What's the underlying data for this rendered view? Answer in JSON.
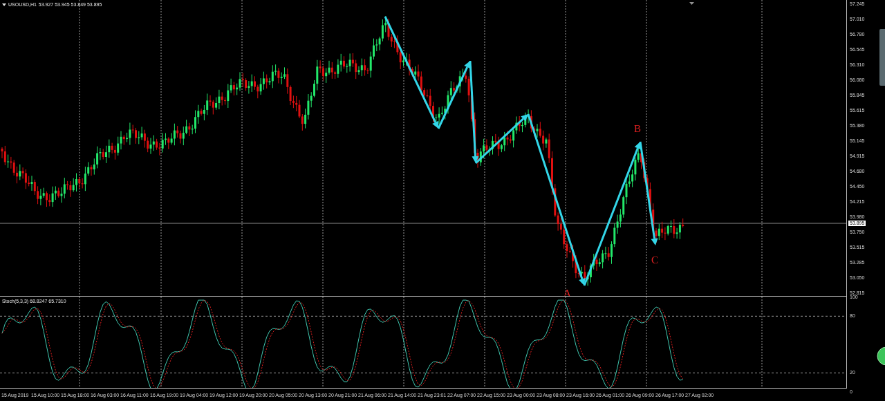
{
  "chart": {
    "symbol": "USOUSD,H1",
    "ohlc": "53.927 53.945 53.849 53.895",
    "current_price": "53.895"
  },
  "price_axis": [
    "57.245",
    "57.010",
    "56.780",
    "56.545",
    "56.310",
    "56.080",
    "55.845",
    "55.615",
    "55.380",
    "55.145",
    "54.915",
    "54.680",
    "54.450",
    "54.215",
    "53.980",
    "53.750",
    "53.515",
    "53.285",
    "53.050",
    "52.815"
  ],
  "wave_labels": [
    {
      "label": "A"
    },
    {
      "label": "B"
    },
    {
      "label": "C"
    }
  ],
  "indicator": {
    "label": "Stoch(5,3,3) 68.8247 65.7310",
    "axis": [
      "100",
      "80",
      "20",
      "0"
    ]
  },
  "time_axis": [
    "15 Aug 2019",
    "15 Aug 10:00",
    "15 Aug 18:00",
    "16 Aug 03:00",
    "16 Aug 11:00",
    "16 Aug 19:00",
    "19 Aug 04:00",
    "19 Aug 12:00",
    "19 Aug 20:00",
    "20 Aug 05:00",
    "20 Aug 13:00",
    "20 Aug 21:00",
    "21 Aug 06:00",
    "21 Aug 14:00",
    "21 Aug 23:01",
    "22 Aug 07:00",
    "22 Aug 15:00",
    "23 Aug 00:00",
    "23 Aug 08:00",
    "23 Aug 16:00",
    "26 Aug 01:00",
    "26 Aug 09:00",
    "26 Aug 17:00",
    "27 Aug 02:00"
  ]
}
